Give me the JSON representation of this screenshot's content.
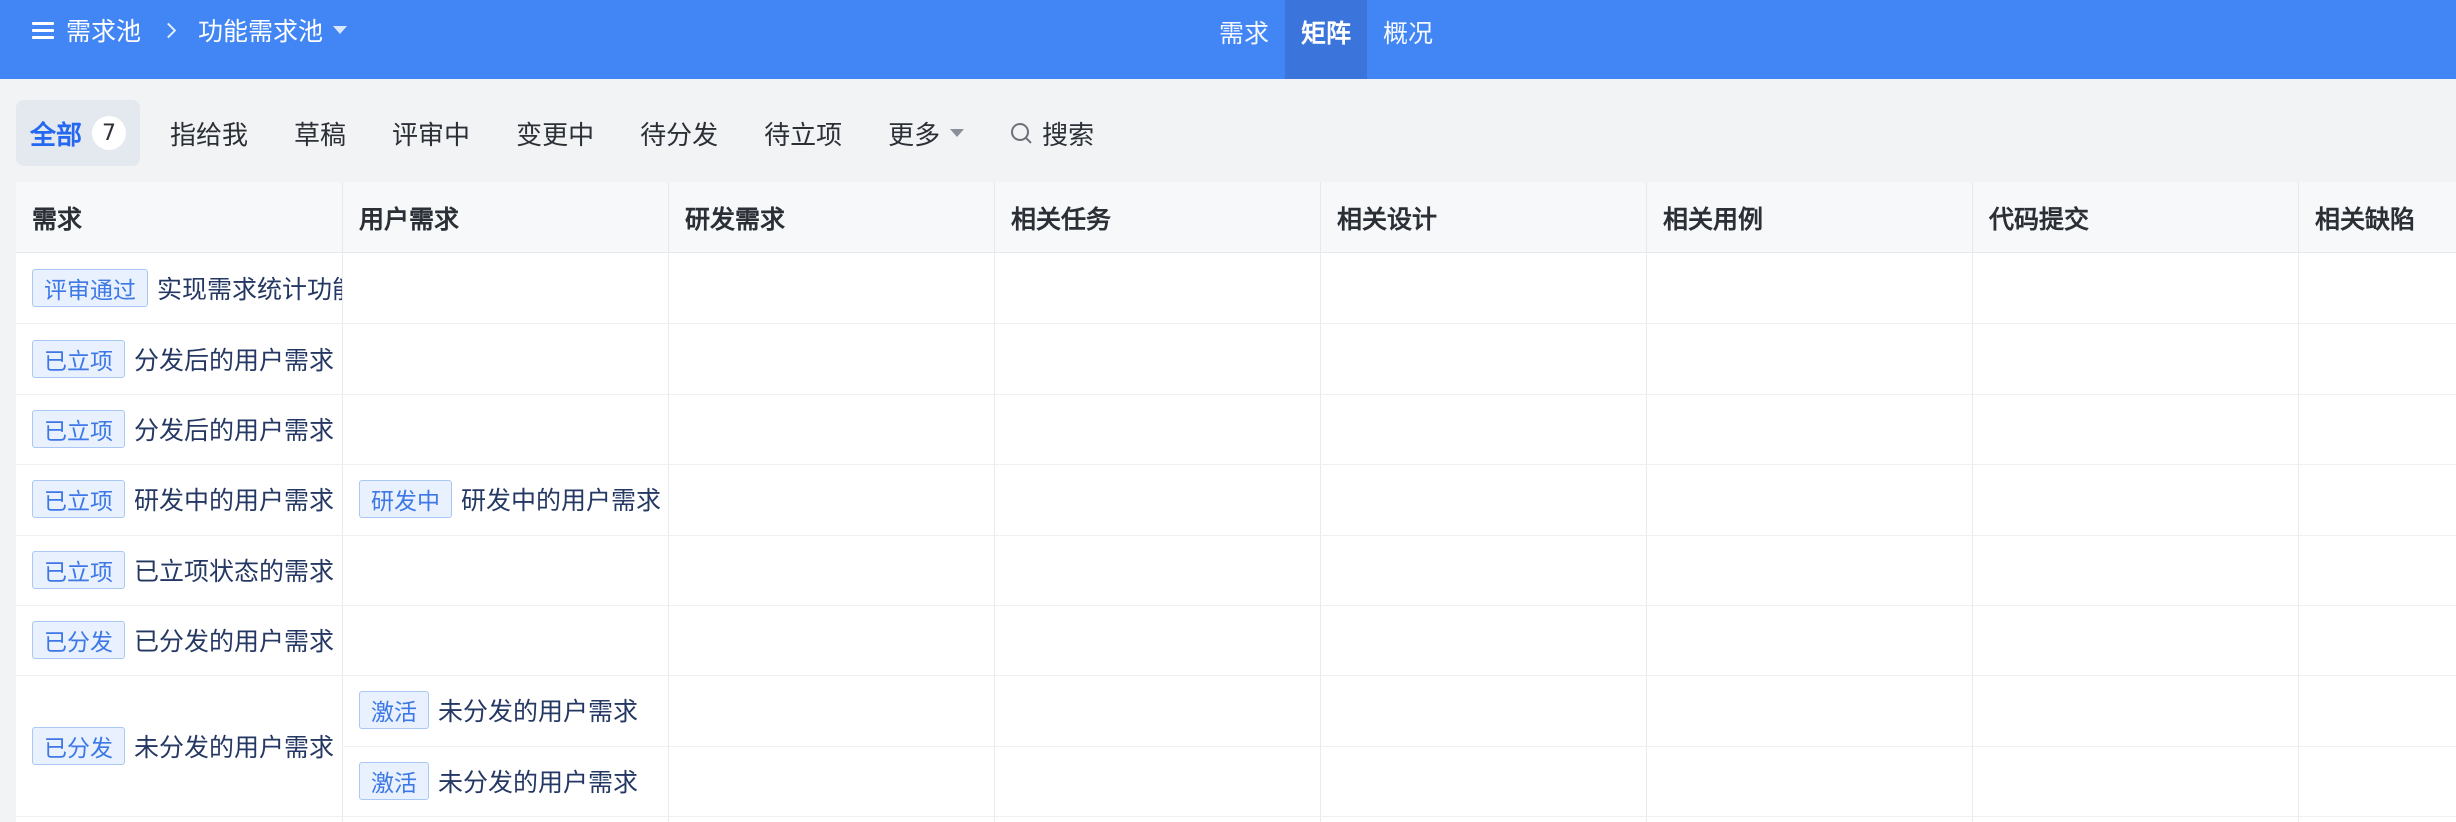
{
  "breadcrumb": {
    "root": "需求池",
    "current": "功能需求池"
  },
  "view_tabs": [
    {
      "label": "需求",
      "active": false
    },
    {
      "label": "矩阵",
      "active": true
    },
    {
      "label": "概况",
      "active": false
    }
  ],
  "filters": {
    "tabs": [
      {
        "label": "全部",
        "count": "7",
        "active": true
      },
      {
        "label": "指给我"
      },
      {
        "label": "草稿"
      },
      {
        "label": "评审中"
      },
      {
        "label": "变更中"
      },
      {
        "label": "待分发"
      },
      {
        "label": "待立项"
      }
    ],
    "more_label": "更多",
    "search_label": "搜索"
  },
  "table": {
    "columns": [
      "需求",
      "用户需求",
      "研发需求",
      "相关任务",
      "相关设计",
      "相关用例",
      "代码提交",
      "相关缺陷"
    ],
    "rows": [
      {
        "status": "评审通过",
        "title": "实现需求统计功能",
        "user_reqs": []
      },
      {
        "status": "已立项",
        "title": "分发后的用户需求",
        "user_reqs": []
      },
      {
        "status": "已立项",
        "title": "分发后的用户需求",
        "user_reqs": []
      },
      {
        "status": "已立项",
        "title": "研发中的用户需求",
        "user_reqs": [
          {
            "status": "研发中",
            "title": "研发中的用户需求"
          }
        ]
      },
      {
        "status": "已立项",
        "title": "已立项状态的需求",
        "user_reqs": []
      },
      {
        "status": "已分发",
        "title": "已分发的用户需求",
        "user_reqs": []
      },
      {
        "status": "已分发",
        "title": "未分发的用户需求",
        "user_reqs": [
          {
            "status": "激活",
            "title": "未分发的用户需求"
          },
          {
            "status": "激活",
            "title": "未分发的用户需求"
          }
        ]
      }
    ]
  },
  "colors": {
    "header_bg": "#4285f4",
    "active_tab_bg": "#3b74db",
    "tag_border": "#a9c8f5",
    "tag_text": "#3d78e6",
    "link_text": "#253863"
  }
}
